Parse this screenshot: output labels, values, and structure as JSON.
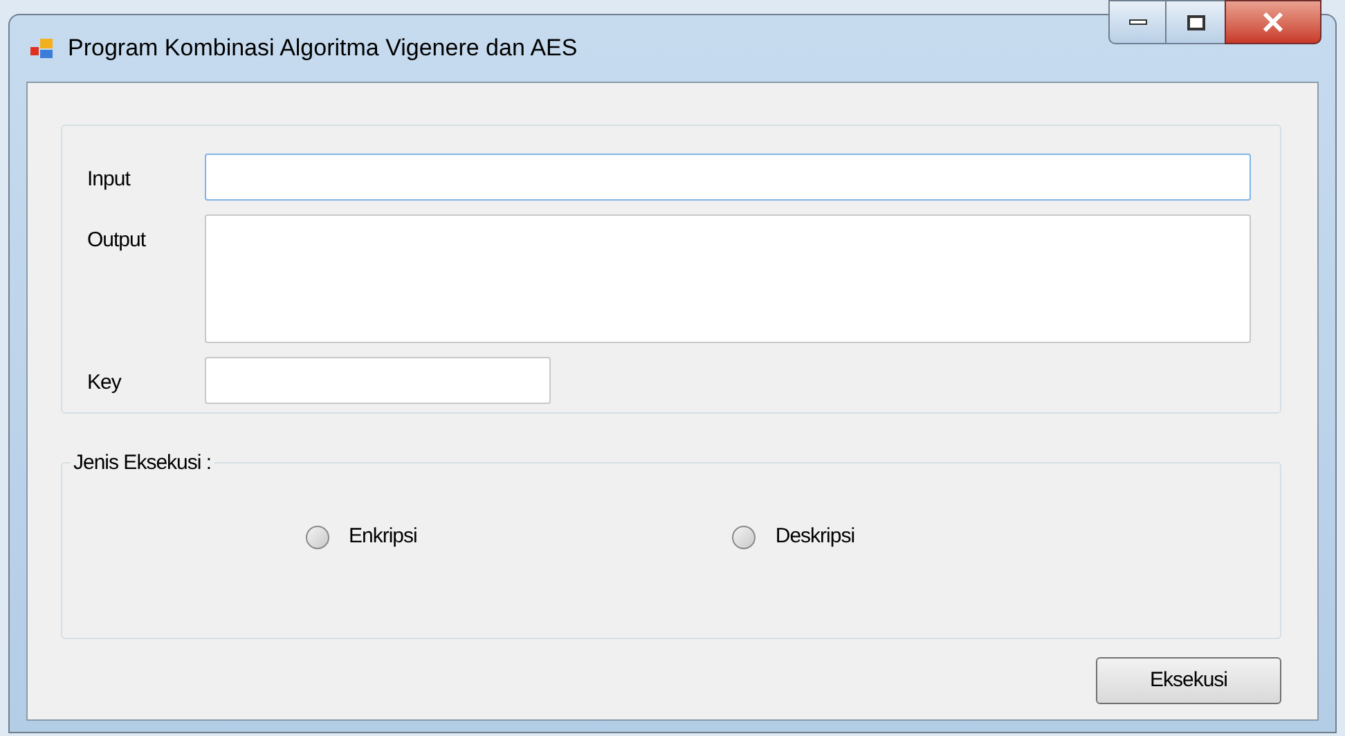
{
  "window": {
    "title": "Program Kombinasi Algoritma Vigenere dan AES"
  },
  "fields": [
    {
      "label": "Input",
      "kind": "line"
    },
    {
      "label": "Output",
      "kind": "multiline"
    },
    {
      "label": "Key",
      "kind": "short"
    }
  ],
  "execution_group": {
    "legend": "Jenis Eksekusi :",
    "options": [
      {
        "label": "Enkripsi",
        "selected": false
      },
      {
        "label": "Deskripsi",
        "selected": false
      }
    ]
  },
  "buttons": [
    "Eksekusi"
  ]
}
